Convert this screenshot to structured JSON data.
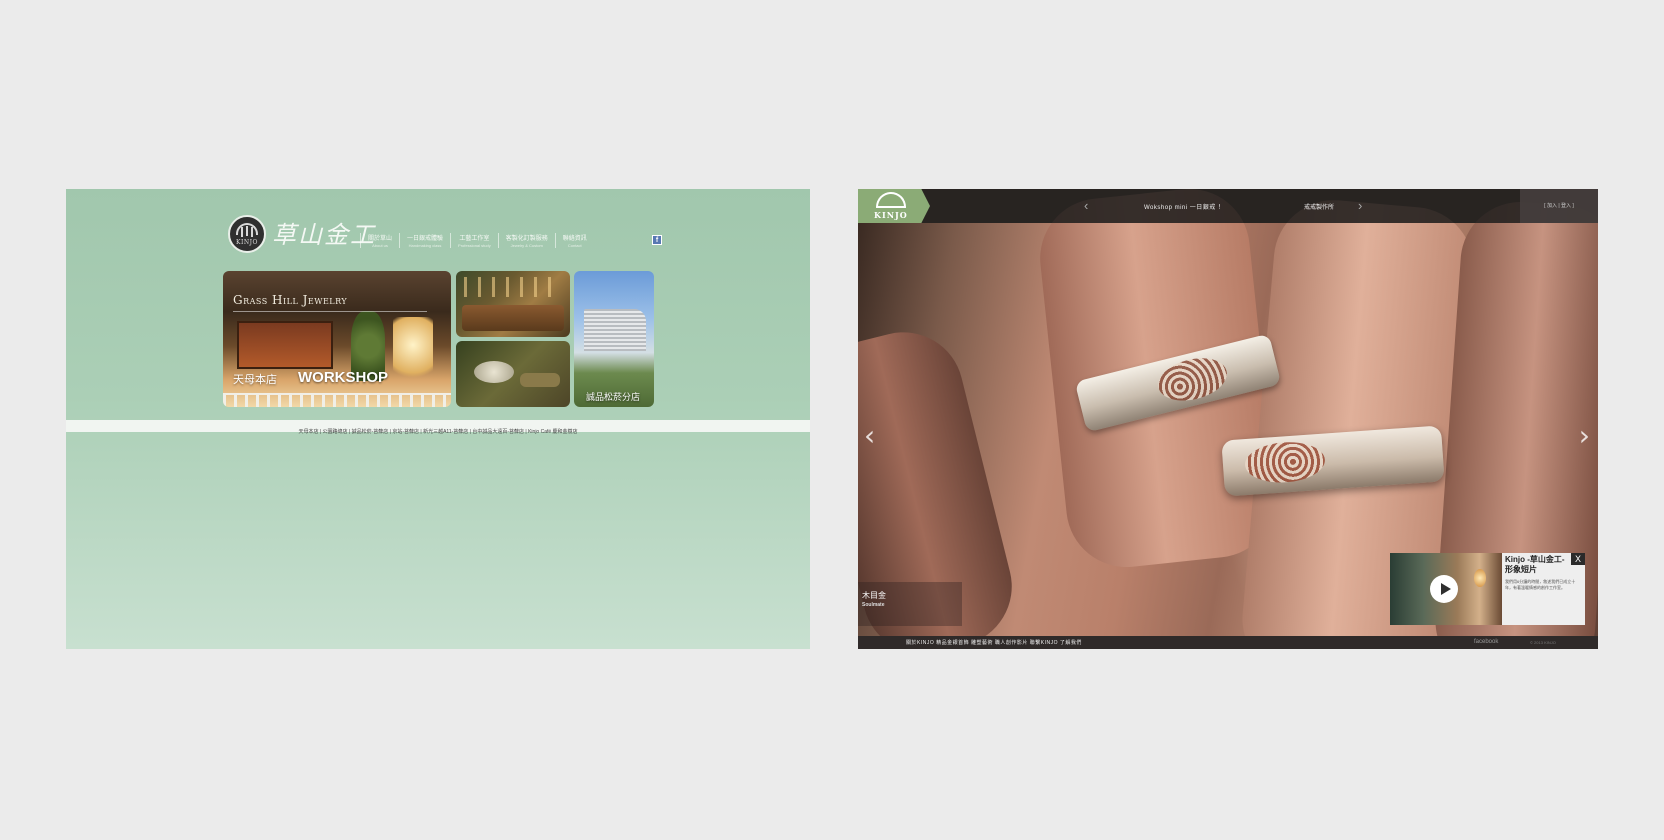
{
  "left_site": {
    "logo_seal_text": "KINJO",
    "logo_script": "草山金工",
    "nav": [
      {
        "zh": "關於草山",
        "en": "About us"
      },
      {
        "zh": "一日銀戒體驗",
        "en": "Handmaking class"
      },
      {
        "zh": "工藝工作室",
        "en": "Professional study"
      },
      {
        "zh": "客製化訂製服務",
        "en": "Jewelry & Custom"
      },
      {
        "zh": "聯絡資訊",
        "en": "Contact"
      }
    ],
    "fb_label": "f",
    "tiles": {
      "workshop_title": "Grass Hill Jewelry",
      "workshop_zh": "天母本店",
      "workshop_en": "WORKSHOP",
      "hotel_label": "誠品松菸分店"
    },
    "link_bar": "天母本店 | 公園路總店 | 誠品松菸-苔蘚店 | 京站-苔蘚店 | 新光三越A11-苔蘚店 | 台中誠品大遠百-苔蘚店 | Kinjo Café 慶和金樹店"
  },
  "right_site": {
    "logo_word": "KINJO",
    "ticker_left": "‹",
    "ticker_text1": "Wokshop mini 一日銀戒 ！",
    "ticker_text2": "戒戒製作所",
    "ticker_right": "›",
    "login": "[ 加入 | 登入 ]",
    "arrow_prev": "‹",
    "arrow_next": "›",
    "caption_title": "木目金",
    "caption_sub": "Soulmate",
    "video": {
      "title": "Kinjo -草山金工-形象短片",
      "desc": "我們用6分鐘的時間，敘述我們已成立十年，有著溫暖情感的創作工作室。",
      "close": "X"
    },
    "footer_links": "關於KINJO    精品金銀首飾    雕塑藝術    職人創作影片    聯繫KINJO    了解我們",
    "footer_fb": "facebook",
    "footer_copy": "© 2013 KINJO"
  }
}
